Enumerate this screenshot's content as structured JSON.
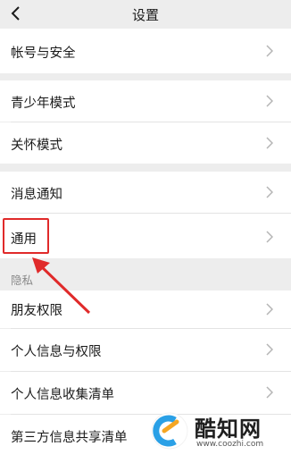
{
  "nav": {
    "title": "设置",
    "back_icon": "chevron-left-icon"
  },
  "groups": [
    {
      "items": [
        {
          "label": "帐号与安全"
        }
      ]
    },
    {
      "items": [
        {
          "label": "青少年模式"
        },
        {
          "label": "关怀模式"
        }
      ]
    },
    {
      "items": [
        {
          "label": "消息通知"
        },
        {
          "label": "通用"
        }
      ]
    },
    {
      "section_label": "隐私",
      "items": [
        {
          "label": "朋友权限"
        },
        {
          "label": "个人信息与权限"
        },
        {
          "label": "个人信息收集清单"
        },
        {
          "label": "第三方信息共享清单"
        }
      ]
    }
  ],
  "annotation": {
    "highlight_color": "#e02a2a"
  },
  "watermark": {
    "title": "酷知网",
    "url": "www.coozhi.com"
  }
}
